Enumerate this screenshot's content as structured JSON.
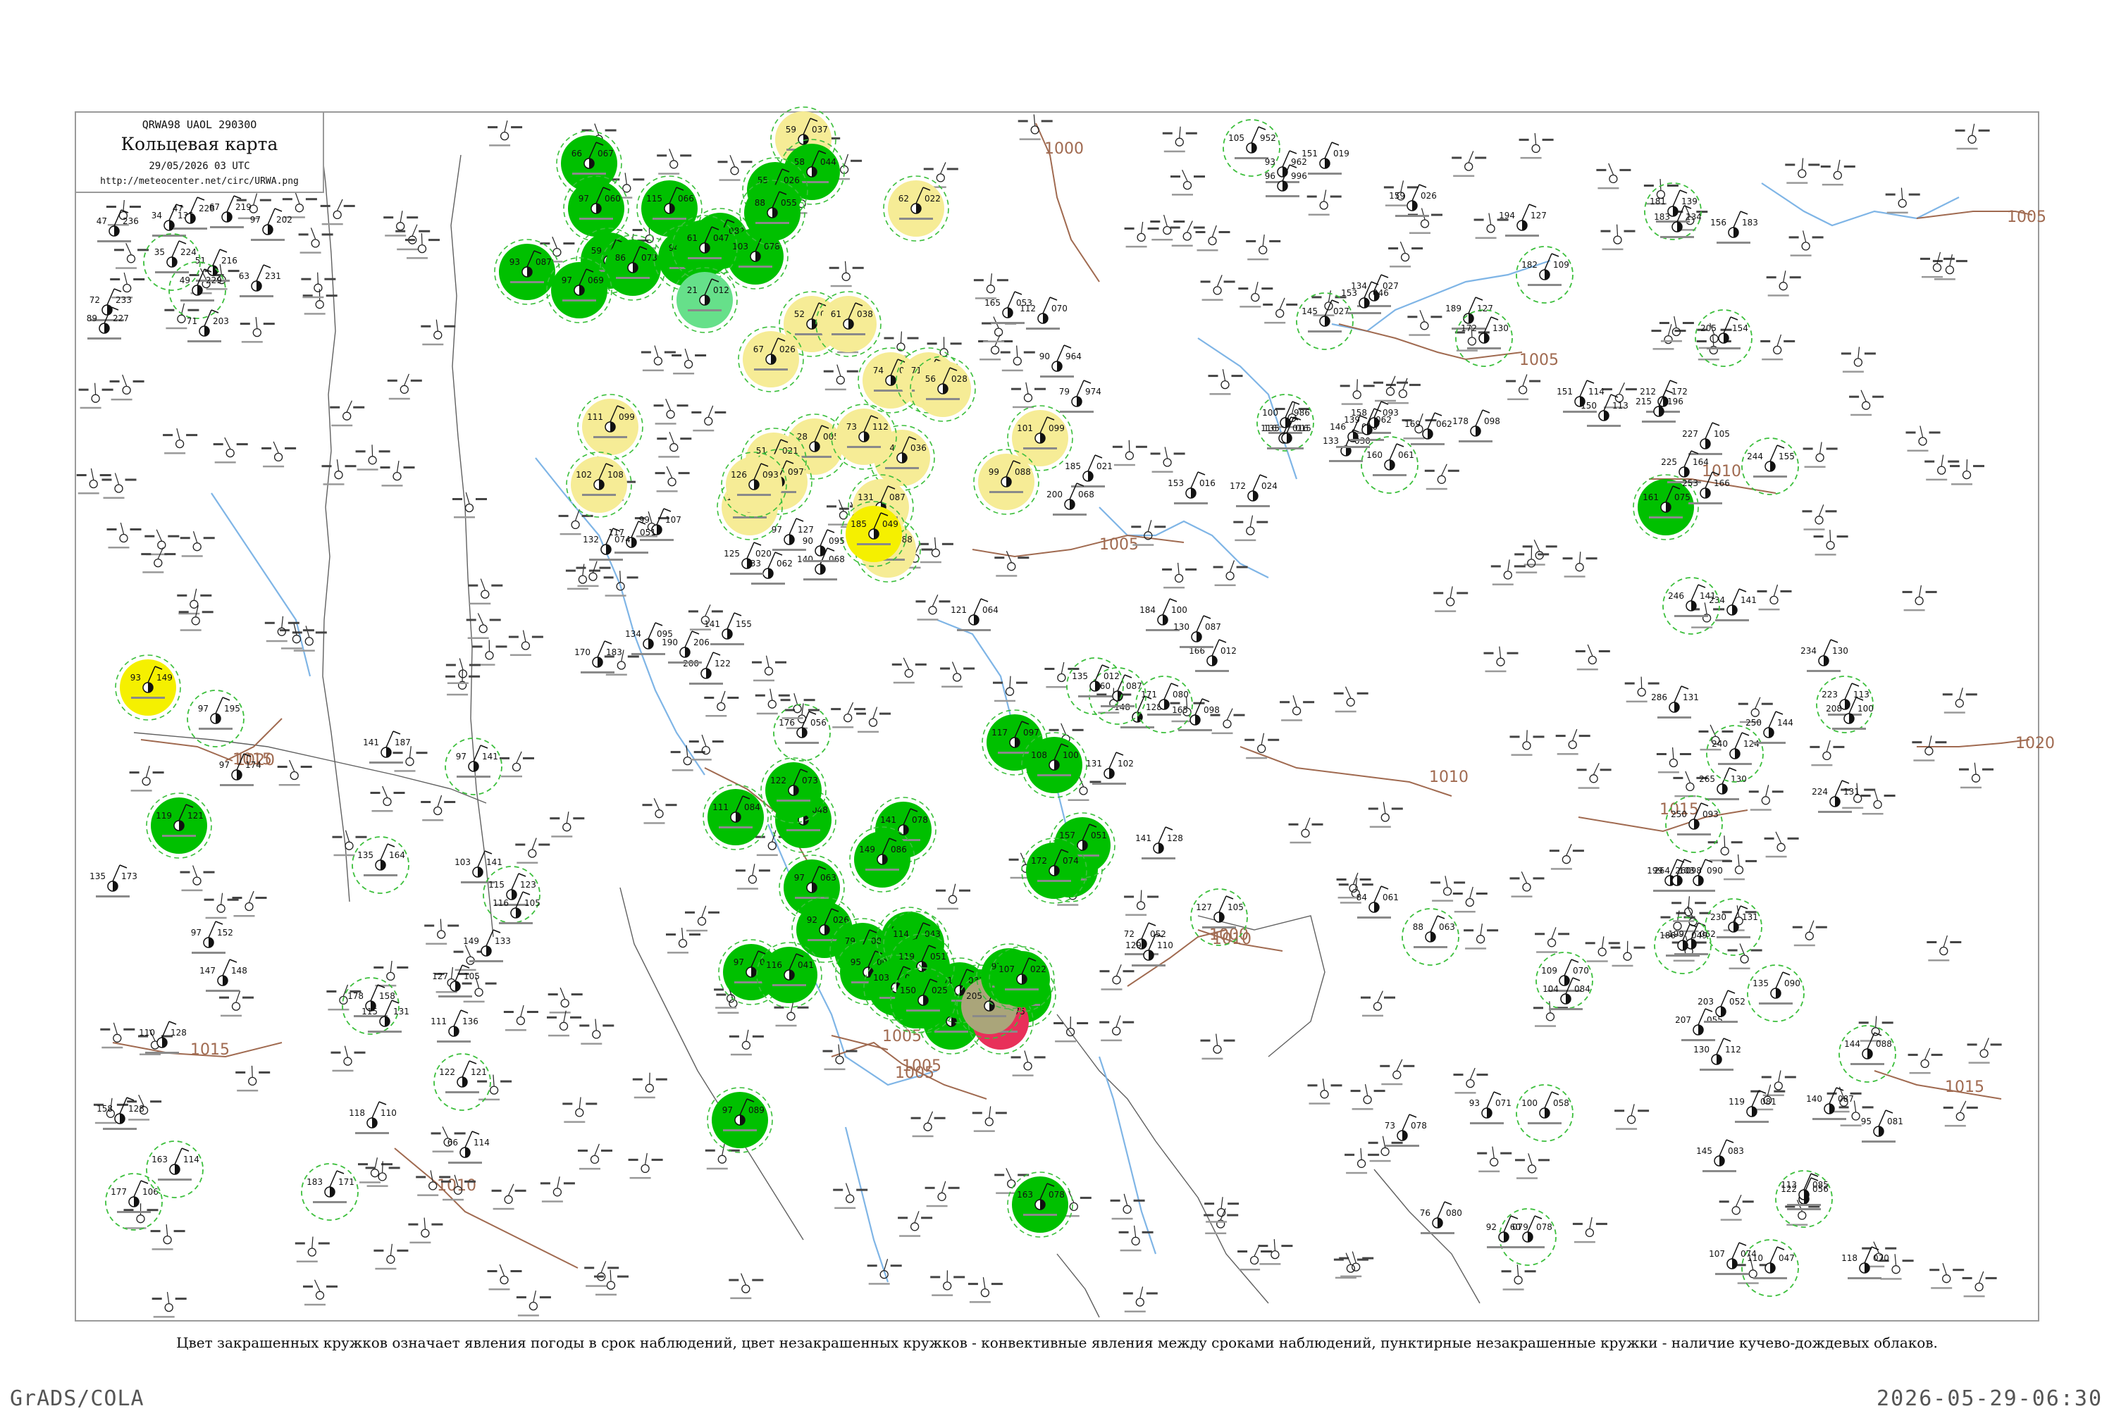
{
  "header": {
    "code": "QRWA98  UAOL  29030О",
    "title": "Кольцевая карта",
    "time": "29/05/2026 03 UTC",
    "url": "http://meteocenter.net/circ/URWA.png"
  },
  "caption": "Цвет закрашенных кружков означает явления погоды в срок наблюдений, цвет незакрашенных кружков - конвективные явления между сроками наблюдений, пунктирные незакрашенные кружки - наличие кучево-дождевых облаков.",
  "footer": {
    "left": "GrADS/COLA",
    "right": "2026-05-29-06:30"
  },
  "colors": {
    "frame": "#9a9a9a",
    "rain_green": "#00c000",
    "shower_yellow": "#f6ec96",
    "fog_yellow": "#f5f000",
    "thunder_red": "#e8305a",
    "dust_olive": "#aaa57a",
    "drizzle_lightgreen": "#66e08a",
    "ring_green": "#3cbf3c",
    "isobar": "#a06a50",
    "river": "#7fb5e6",
    "border": "#606060"
  },
  "isobars": [
    {
      "label": "1000"
    },
    {
      "label": "1005"
    },
    {
      "label": "1005"
    },
    {
      "label": "1005"
    },
    {
      "label": "1005"
    },
    {
      "label": "1005"
    },
    {
      "label": "1010"
    },
    {
      "label": "1010"
    },
    {
      "label": "1010"
    },
    {
      "label": "1010"
    },
    {
      "label": "1015"
    },
    {
      "label": "1015"
    },
    {
      "label": "1015"
    },
    {
      "label": "1015"
    },
    {
      "label": "1020"
    },
    {
      "label": "1020"
    },
    {
      "label": "1000"
    },
    {
      "label": "1005"
    }
  ],
  "stations": [
    {
      "t": "47",
      "p": "236",
      "f": "none"
    },
    {
      "t": "34",
      "p": "135",
      "f": "none"
    },
    {
      "t": "47",
      "p": "228",
      "f": "none"
    },
    {
      "t": "67",
      "p": "219",
      "f": "none"
    },
    {
      "t": "97",
      "p": "202",
      "f": "none"
    },
    {
      "t": "35",
      "p": "224",
      "f": "none"
    },
    {
      "t": "51",
      "p": "216",
      "f": "none"
    },
    {
      "t": "63",
      "p": "231",
      "f": "none"
    },
    {
      "t": "49",
      "p": "229",
      "f": "none"
    },
    {
      "t": "71",
      "p": "203",
      "f": "none"
    },
    {
      "t": "72",
      "p": "233",
      "f": "none"
    },
    {
      "t": "89",
      "p": "227",
      "f": "none"
    },
    {
      "t": "93",
      "p": "149",
      "f": "fog_yellow"
    },
    {
      "t": "97",
      "p": "195",
      "f": "none"
    },
    {
      "t": "97",
      "p": "174",
      "f": "none"
    },
    {
      "t": "119",
      "p": "121",
      "f": "rain_green"
    },
    {
      "t": "135",
      "p": "173",
      "f": "none"
    },
    {
      "t": "97",
      "p": "152",
      "f": "none"
    },
    {
      "t": "147",
      "p": "148",
      "f": "none"
    },
    {
      "t": "110",
      "p": "128",
      "f": "none"
    },
    {
      "t": "158",
      "p": "128",
      "f": "none"
    },
    {
      "t": "177",
      "p": "106",
      "f": "none"
    },
    {
      "t": "163",
      "p": "114",
      "f": "none"
    },
    {
      "t": "183",
      "p": "171",
      "f": "none"
    },
    {
      "t": "118",
      "p": "110",
      "f": "none"
    },
    {
      "t": "178",
      "p": "158",
      "f": "none"
    },
    {
      "t": "115",
      "p": "131",
      "f": "none"
    },
    {
      "t": "135",
      "p": "164",
      "f": "none"
    },
    {
      "t": "141",
      "p": "187",
      "f": "none"
    },
    {
      "t": "127",
      "p": "105",
      "f": "none"
    },
    {
      "t": "122",
      "p": "121",
      "f": "none"
    },
    {
      "t": "66",
      "p": "114",
      "f": "none"
    },
    {
      "t": "103",
      "p": "141",
      "f": "none"
    },
    {
      "t": "115",
      "p": "123",
      "f": "none"
    },
    {
      "t": "111",
      "p": "136",
      "f": "none"
    },
    {
      "t": "149",
      "p": "133",
      "f": "none"
    },
    {
      "t": "97",
      "p": "141",
      "f": "none"
    },
    {
      "t": "116",
      "p": "105",
      "f": "none"
    },
    {
      "t": "93",
      "p": "087",
      "f": "rain_green"
    },
    {
      "t": "66",
      "p": "067",
      "f": "rain_green"
    },
    {
      "t": "97",
      "p": "060",
      "f": "rain_green"
    },
    {
      "t": "115",
      "p": "066",
      "f": "rain_green"
    },
    {
      "t": "59",
      "p": "067",
      "f": "rain_green"
    },
    {
      "t": "86",
      "p": "073",
      "f": "rain_green"
    },
    {
      "t": "94",
      "p": "068",
      "f": "rain_green"
    },
    {
      "t": "97",
      "p": "069",
      "f": "rain_green"
    },
    {
      "t": "84",
      "p": "082",
      "f": "rain_green"
    },
    {
      "t": "103",
      "p": "078",
      "f": "rain_green"
    },
    {
      "t": "61",
      "p": "047",
      "f": "rain_green"
    },
    {
      "t": "21",
      "p": "012",
      "f": "drizzle_lightgreen"
    },
    {
      "t": "59",
      "p": "037",
      "f": "shower_yellow"
    },
    {
      "t": "58",
      "p": "044",
      "f": "rain_green"
    },
    {
      "t": "55",
      "p": "026",
      "f": "rain_green"
    },
    {
      "t": "88",
      "p": "055",
      "f": "rain_green"
    },
    {
      "t": "52",
      "p": "048",
      "f": "shower_yellow"
    },
    {
      "t": "74",
      "p": "020",
      "f": "shower_yellow"
    },
    {
      "t": "67",
      "p": "026",
      "f": "shower_yellow"
    },
    {
      "t": "61",
      "p": "038",
      "f": "shower_yellow"
    },
    {
      "t": "28",
      "p": "005",
      "f": "shower_yellow"
    },
    {
      "t": "51",
      "p": "021",
      "f": "shower_yellow"
    },
    {
      "t": "62",
      "p": "022",
      "f": "shower_yellow"
    },
    {
      "t": "71",
      "p": "061",
      "f": "shower_yellow"
    },
    {
      "t": "56",
      "p": "028",
      "f": "shower_yellow"
    },
    {
      "t": "74",
      "p": "036",
      "f": "shower_yellow"
    },
    {
      "t": "88",
      "p": "088",
      "f": "shower_yellow"
    },
    {
      "t": "73",
      "p": "112",
      "f": "shower_yellow"
    },
    {
      "t": "101",
      "p": "099",
      "f": "shower_yellow"
    },
    {
      "t": "99",
      "p": "088",
      "f": "shower_yellow"
    },
    {
      "t": "88",
      "p": "097",
      "f": "shower_yellow"
    },
    {
      "t": "112",
      "p": "092",
      "f": "shower_yellow"
    },
    {
      "t": "111",
      "p": "099",
      "f": "shower_yellow"
    },
    {
      "t": "102",
      "p": "108",
      "f": "shower_yellow"
    },
    {
      "t": "126",
      "p": "093",
      "f": "shower_yellow"
    },
    {
      "t": "131",
      "p": "087",
      "f": "shower_yellow"
    },
    {
      "t": "185",
      "p": "049",
      "f": "fog_yellow"
    },
    {
      "t": "111",
      "p": "084",
      "f": "rain_green"
    },
    {
      "t": "109",
      "p": "048",
      "f": "rain_green"
    },
    {
      "t": "97",
      "p": "089",
      "f": "rain_green"
    },
    {
      "t": "122",
      "p": "073",
      "f": "rain_green"
    },
    {
      "t": "141",
      "p": "078",
      "f": "rain_green"
    },
    {
      "t": "149",
      "p": "086",
      "f": "rain_green"
    },
    {
      "t": "117",
      "p": "097",
      "f": "rain_green"
    },
    {
      "t": "108",
      "p": "100",
      "f": "rain_green"
    },
    {
      "t": "154",
      "p": "089",
      "f": "rain_green"
    },
    {
      "t": "163",
      "p": "078",
      "f": "rain_green"
    },
    {
      "t": "161",
      "p": "075",
      "f": "rain_green"
    },
    {
      "t": "157",
      "p": "051",
      "f": "rain_green"
    },
    {
      "t": "172",
      "p": "074",
      "f": "rain_green"
    },
    {
      "t": "97",
      "p": "058",
      "f": "rain_green"
    },
    {
      "t": "128",
      "p": "078",
      "f": "rain_green"
    },
    {
      "t": "133",
      "p": "056",
      "f": "rain_green"
    },
    {
      "t": "97",
      "p": "063",
      "f": "rain_green"
    },
    {
      "t": "92",
      "p": "026",
      "f": "rain_green"
    },
    {
      "t": "79",
      "p": "008",
      "f": "rain_green"
    },
    {
      "t": "95",
      "p": "004",
      "f": "rain_green"
    },
    {
      "t": "83",
      "p": "029",
      "f": "rain_green"
    },
    {
      "t": "114",
      "p": "043",
      "f": "rain_green"
    },
    {
      "t": "93",
      "p": "023",
      "f": "rain_green"
    },
    {
      "t": "101",
      "p": "031",
      "f": "rain_green"
    },
    {
      "t": "97",
      "p": "044",
      "f": "rain_green"
    },
    {
      "t": "116",
      "p": "041",
      "f": "rain_green"
    },
    {
      "t": "119",
      "p": "051",
      "f": "rain_green"
    },
    {
      "t": "103",
      "p": "040",
      "f": "rain_green"
    },
    {
      "t": "150",
      "p": "025",
      "f": "rain_green"
    },
    {
      "t": "122",
      "p": "075",
      "f": "thunder_red"
    },
    {
      "t": "205",
      "p": "004",
      "f": "dust_olive"
    },
    {
      "t": "97",
      "p": "007",
      "f": "rain_green"
    },
    {
      "t": "107",
      "p": "022",
      "f": "rain_green"
    },
    {
      "t": "165",
      "p": "053",
      "f": "none"
    },
    {
      "t": "112",
      "p": "070",
      "f": "none"
    },
    {
      "t": "90",
      "p": "964",
      "f": "none"
    },
    {
      "t": "79",
      "p": "974",
      "f": "none"
    },
    {
      "t": "105",
      "p": "952",
      "f": "none"
    },
    {
      "t": "93",
      "p": "962",
      "f": "none"
    },
    {
      "t": "96",
      "p": "996",
      "f": "none"
    },
    {
      "t": "100",
      "p": "986",
      "f": "none"
    },
    {
      "t": "116",
      "p": "016",
      "f": "none"
    },
    {
      "t": "135",
      "p": "015",
      "f": "none"
    },
    {
      "t": "151",
      "p": "019",
      "f": "none"
    },
    {
      "t": "159",
      "p": "026",
      "f": "none"
    },
    {
      "t": "134",
      "p": "027",
      "f": "none"
    },
    {
      "t": "145",
      "p": "027",
      "f": "none"
    },
    {
      "t": "153",
      "p": "046",
      "f": "none"
    },
    {
      "t": "133",
      "p": "030",
      "f": "none"
    },
    {
      "t": "146",
      "p": "056",
      "f": "none"
    },
    {
      "t": "158",
      "p": "093",
      "f": "none"
    },
    {
      "t": "139",
      "p": "062",
      "f": "none"
    },
    {
      "t": "160",
      "p": "061",
      "f": "none"
    },
    {
      "t": "169",
      "p": "062",
      "f": "none"
    },
    {
      "t": "178",
      "p": "098",
      "f": "none"
    },
    {
      "t": "189",
      "p": "127",
      "f": "none"
    },
    {
      "t": "172",
      "p": "130",
      "f": "none"
    },
    {
      "t": "194",
      "p": "127",
      "f": "none"
    },
    {
      "t": "182",
      "p": "109",
      "f": "none"
    },
    {
      "t": "150",
      "p": "113",
      "f": "none"
    },
    {
      "t": "151",
      "p": "114",
      "f": "none"
    },
    {
      "t": "181",
      "p": "139",
      "f": "none"
    },
    {
      "t": "183",
      "p": "134",
      "f": "none"
    },
    {
      "t": "156",
      "p": "183",
      "f": "none"
    },
    {
      "t": "205",
      "p": "154",
      "f": "none"
    },
    {
      "t": "212",
      "p": "172",
      "f": "none"
    },
    {
      "t": "215",
      "p": "196",
      "f": "none"
    },
    {
      "t": "227",
      "p": "105",
      "f": "none"
    },
    {
      "t": "225",
      "p": "164",
      "f": "none"
    },
    {
      "t": "253",
      "p": "166",
      "f": "none"
    },
    {
      "t": "244",
      "p": "155",
      "f": "none"
    },
    {
      "t": "234",
      "p": "141",
      "f": "none"
    },
    {
      "t": "246",
      "p": "141",
      "f": "none"
    },
    {
      "t": "265",
      "p": "130",
      "f": "none"
    },
    {
      "t": "286",
      "p": "131",
      "f": "none"
    },
    {
      "t": "240",
      "p": "124",
      "f": "none"
    },
    {
      "t": "250",
      "p": "144",
      "f": "none"
    },
    {
      "t": "234",
      "p": "130",
      "f": "none"
    },
    {
      "t": "223",
      "p": "113",
      "f": "none"
    },
    {
      "t": "208",
      "p": "100",
      "f": "none"
    },
    {
      "t": "199",
      "p": "103",
      "f": "none"
    },
    {
      "t": "250",
      "p": "093",
      "f": "none"
    },
    {
      "t": "264",
      "p": "098",
      "f": "none"
    },
    {
      "t": "260",
      "p": "090",
      "f": "none"
    },
    {
      "t": "230",
      "p": "131",
      "f": "none"
    },
    {
      "t": "224",
      "p": "131",
      "f": "none"
    },
    {
      "t": "199",
      "p": "062",
      "f": "none"
    },
    {
      "t": "186",
      "p": "049",
      "f": "none"
    },
    {
      "t": "207",
      "p": "055",
      "f": "none"
    },
    {
      "t": "203",
      "p": "052",
      "f": "none"
    },
    {
      "t": "135",
      "p": "090",
      "f": "none"
    },
    {
      "t": "130",
      "p": "112",
      "f": "none"
    },
    {
      "t": "119",
      "p": "081",
      "f": "none"
    },
    {
      "t": "144",
      "p": "088",
      "f": "none"
    },
    {
      "t": "140",
      "p": "087",
      "f": "none"
    },
    {
      "t": "145",
      "p": "083",
      "f": "none"
    },
    {
      "t": "122",
      "p": "056",
      "f": "none"
    },
    {
      "t": "95",
      "p": "081",
      "f": "none"
    },
    {
      "t": "113",
      "p": "085",
      "f": "none"
    },
    {
      "t": "110",
      "p": "047",
      "f": "none"
    },
    {
      "t": "118",
      "p": "070",
      "f": "none"
    },
    {
      "t": "107",
      "p": "074",
      "f": "none"
    },
    {
      "t": "109",
      "p": "070",
      "f": "none"
    },
    {
      "t": "104",
      "p": "084",
      "f": "none"
    },
    {
      "t": "84",
      "p": "061",
      "f": "none"
    },
    {
      "t": "88",
      "p": "063",
      "f": "none"
    },
    {
      "t": "73",
      "p": "078",
      "f": "none"
    },
    {
      "t": "76",
      "p": "080",
      "f": "none"
    },
    {
      "t": "60",
      "p": "078",
      "f": "none"
    },
    {
      "t": "92",
      "p": "079",
      "f": "none"
    },
    {
      "t": "93",
      "p": "071",
      "f": "none"
    },
    {
      "t": "100",
      "p": "058",
      "f": "none"
    },
    {
      "t": "72",
      "p": "052",
      "f": "none"
    },
    {
      "t": "129",
      "p": "110",
      "f": "none"
    },
    {
      "t": "127",
      "p": "105",
      "f": "none"
    },
    {
      "t": "141",
      "p": "128",
      "f": "none"
    },
    {
      "t": "131",
      "p": "102",
      "f": "none"
    },
    {
      "t": "148",
      "p": "128",
      "f": "none"
    },
    {
      "t": "160",
      "p": "087",
      "f": "none"
    },
    {
      "t": "184",
      "p": "100",
      "f": "none"
    },
    {
      "t": "165",
      "p": "098",
      "f": "none"
    },
    {
      "t": "171",
      "p": "080",
      "f": "none"
    },
    {
      "t": "166",
      "p": "012",
      "f": "none"
    },
    {
      "t": "130",
      "p": "087",
      "f": "none"
    },
    {
      "t": "135",
      "p": "012",
      "f": "none"
    },
    {
      "t": "153",
      "p": "016",
      "f": "none"
    },
    {
      "t": "172",
      "p": "024",
      "f": "none"
    },
    {
      "t": "185",
      "p": "021",
      "f": "none"
    },
    {
      "t": "200",
      "p": "068",
      "f": "none"
    },
    {
      "t": "121",
      "p": "064",
      "f": "none"
    },
    {
      "t": "176",
      "p": "056",
      "f": "none"
    },
    {
      "t": "140",
      "p": "068",
      "f": "none"
    },
    {
      "t": "133",
      "p": "062",
      "f": "none"
    },
    {
      "t": "125",
      "p": "020",
      "f": "none"
    },
    {
      "t": "90",
      "p": "095",
      "f": "none"
    },
    {
      "t": "97",
      "p": "127",
      "f": "none"
    },
    {
      "t": "99",
      "p": "107",
      "f": "none"
    },
    {
      "t": "117",
      "p": "051",
      "f": "none"
    },
    {
      "t": "132",
      "p": "074",
      "f": "none"
    },
    {
      "t": "134",
      "p": "095",
      "f": "none"
    },
    {
      "t": "141",
      "p": "155",
      "f": "none"
    },
    {
      "t": "200",
      "p": "122",
      "f": "none"
    },
    {
      "t": "190",
      "p": "206",
      "f": "none"
    },
    {
      "t": "170",
      "p": "183",
      "f": "none"
    }
  ]
}
